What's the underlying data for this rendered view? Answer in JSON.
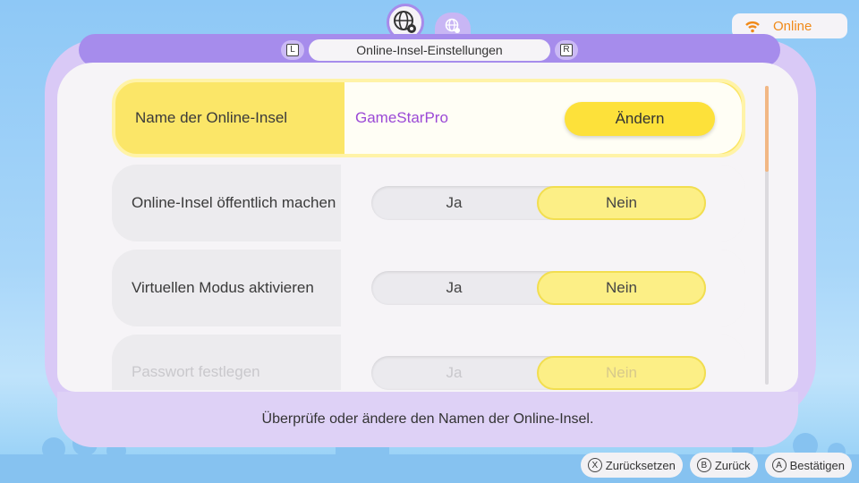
{
  "status": {
    "label": "Online",
    "icon": "wifi-icon",
    "color": "#f08a19"
  },
  "tabs": [
    {
      "icon": "globe-gear-icon",
      "active": true
    },
    {
      "icon": "globe-icon",
      "active": false
    }
  ],
  "header": {
    "title": "Online-Insel-Einstellungen",
    "left_key": "L",
    "right_key": "R"
  },
  "rows": [
    {
      "label": "Name der Online-Insel",
      "value": "GameStarPro",
      "button": "Ändern"
    },
    {
      "label": "Online-Insel öffentlich machen",
      "option_yes": "Ja",
      "option_no": "Nein",
      "selected": "Nein"
    },
    {
      "label": "Virtuellen Modus aktivieren",
      "option_yes": "Ja",
      "option_no": "Nein",
      "selected": "Nein"
    },
    {
      "label": "Passwort festlegen",
      "option_yes": "Ja",
      "option_no": "Nein",
      "selected": "Nein"
    }
  ],
  "footer": {
    "description": "Überprüfe oder ändere den Namen der Online-Insel."
  },
  "hints": [
    {
      "key": "X",
      "label": "Zurücksetzen"
    },
    {
      "key": "B",
      "label": "Zurück"
    },
    {
      "key": "A",
      "label": "Bestätigen"
    }
  ]
}
